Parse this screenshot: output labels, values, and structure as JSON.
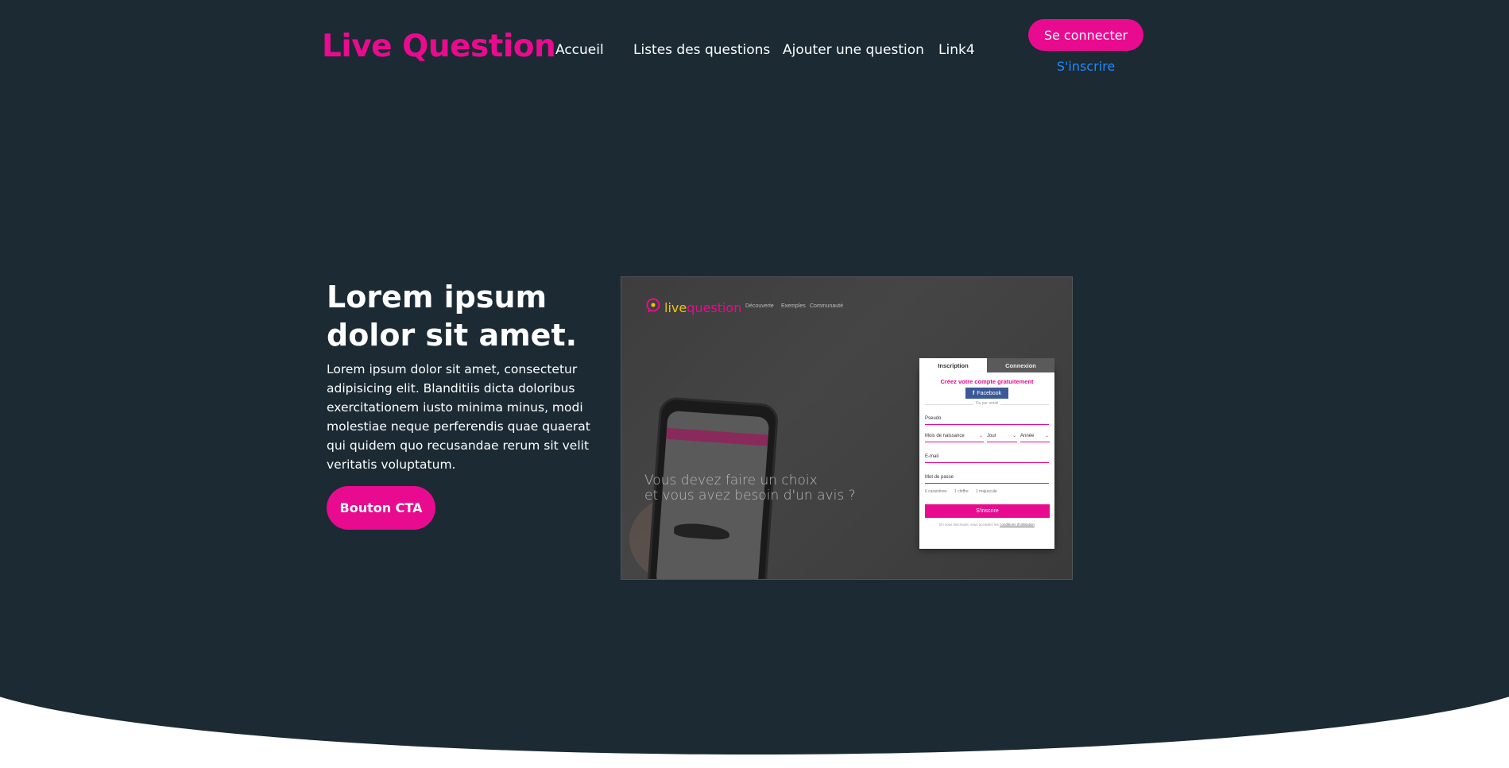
{
  "header": {
    "logo": "Live Question",
    "nav": [
      {
        "label": "Accueil"
      },
      {
        "label": "Listes des questions"
      },
      {
        "label": "Ajouter une question"
      },
      {
        "label": "Link4"
      }
    ],
    "login_label": "Se connecter",
    "signup_label": "S'inscrire"
  },
  "hero": {
    "title": "Lorem ipsum dolor sit amet.",
    "text": "Lorem ipsum dolor sit amet, consectetur adipisicing elit. Blanditiis dicta doloribus exercitationem iusto minima minus, modi molestiae neque perferendis quae quaerat qui quidem quo recusandae rerum sit velit veritatis voluptatum.",
    "cta_label": "Bouton CTA"
  },
  "mockup": {
    "logo_part1": "live",
    "logo_part2": "question",
    "nav": [
      "Découverte",
      "Exemples",
      "Communauté"
    ],
    "tagline_line1": "Vous devez faire un choix",
    "tagline_line2": "et vous avez besoin d'un avis ?",
    "form": {
      "tab_signup": "Inscription",
      "tab_login": "Connexion",
      "heading": "Créez votre compte gratuitement",
      "facebook": "Facebook",
      "or": "Ou par email",
      "pseudo": "Pseudo",
      "birth_month": "Mois de naissance",
      "birth_day": "Jour",
      "birth_year": "Année",
      "email": "E-mail",
      "password": "Mot de passe",
      "hint1": "6 caractères",
      "hint2": "1 chiffre",
      "hint3": "1 majuscule",
      "submit": "S'inscrire",
      "legal_prefix": "En vous inscrivant, vous acceptez les",
      "legal_link": "conditions d'utilisation"
    }
  },
  "colors": {
    "background": "#1b2a33",
    "accent": "#e90b8f",
    "link": "#1e8bff"
  }
}
